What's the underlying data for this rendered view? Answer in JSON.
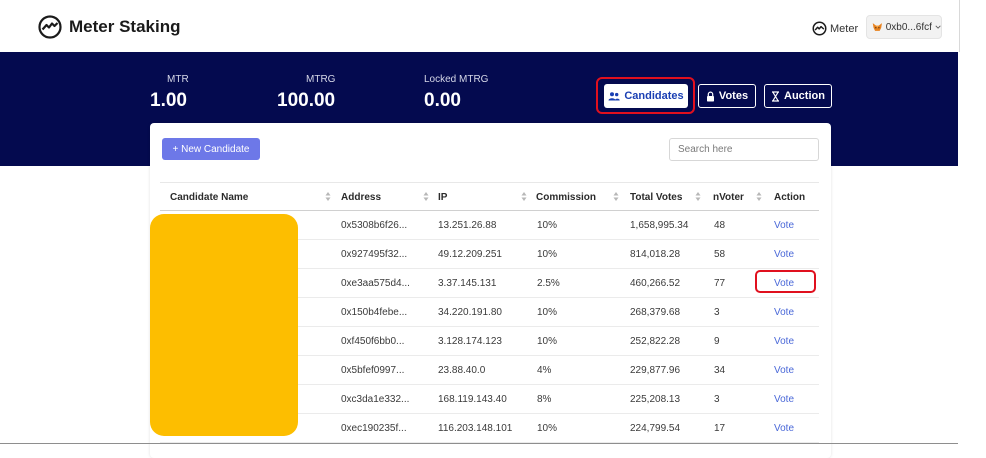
{
  "app": {
    "title": "Meter Staking"
  },
  "header": {
    "network_label": "Meter",
    "wallet_address": "0xb0...6fcf",
    "icons": [
      "meter-logo-icon",
      "metamask-fox-icon",
      "chevron-down-icon"
    ]
  },
  "stats": [
    {
      "label": "MTR",
      "value": "1.00"
    },
    {
      "label": "MTRG",
      "value": "100.00"
    },
    {
      "label": "Locked MTRG",
      "value": "0.00"
    }
  ],
  "nav": {
    "candidates": "Candidates",
    "votes": "Votes",
    "auction": "Auction",
    "active": "Candidates"
  },
  "toolbar": {
    "new_candidate": "+ New Candidate",
    "search_placeholder": "Search here"
  },
  "table": {
    "columns": [
      "Candidate Name",
      "Address",
      "IP",
      "Commission",
      "Total Votes",
      "nVoter",
      "Action"
    ],
    "rows": [
      {
        "address": "0x5308b6f26...",
        "ip": "13.251.26.88",
        "commission": "10%",
        "total_votes": "1,658,995.34",
        "nvoter": "48",
        "action": "Vote"
      },
      {
        "address": "0x927495f32...",
        "ip": "49.12.209.251",
        "commission": "10%",
        "total_votes": "814,018.28",
        "nvoter": "58",
        "action": "Vote"
      },
      {
        "address": "0xe3aa575d4...",
        "ip": "3.37.145.131",
        "commission": "2.5%",
        "total_votes": "460,266.52",
        "nvoter": "77",
        "action": "Vote"
      },
      {
        "address": "0x150b4febe...",
        "ip": "34.220.191.80",
        "commission": "10%",
        "total_votes": "268,379.68",
        "nvoter": "3",
        "action": "Vote"
      },
      {
        "address": "0xf450f6bb0...",
        "ip": "3.128.174.123",
        "commission": "10%",
        "total_votes": "252,822.28",
        "nvoter": "9",
        "action": "Vote"
      },
      {
        "address": "0x5bfef0997...",
        "ip": "23.88.40.0",
        "commission": "4%",
        "total_votes": "229,877.96",
        "nvoter": "34",
        "action": "Vote"
      },
      {
        "address": "0xc3da1e332...",
        "ip": "168.119.143.40",
        "commission": "8%",
        "total_votes": "225,208.13",
        "nvoter": "3",
        "action": "Vote"
      },
      {
        "address": "0xec190235f...",
        "ip": "116.203.148.101",
        "commission": "10%",
        "total_votes": "224,799.54",
        "nvoter": "17",
        "action": "Vote"
      }
    ]
  },
  "colors": {
    "hero_bg": "#040a4f",
    "primary_button": "#6d78e8",
    "link": "#4a68d8",
    "highlight": "#e0101e",
    "redaction": "#fdbe00"
  }
}
